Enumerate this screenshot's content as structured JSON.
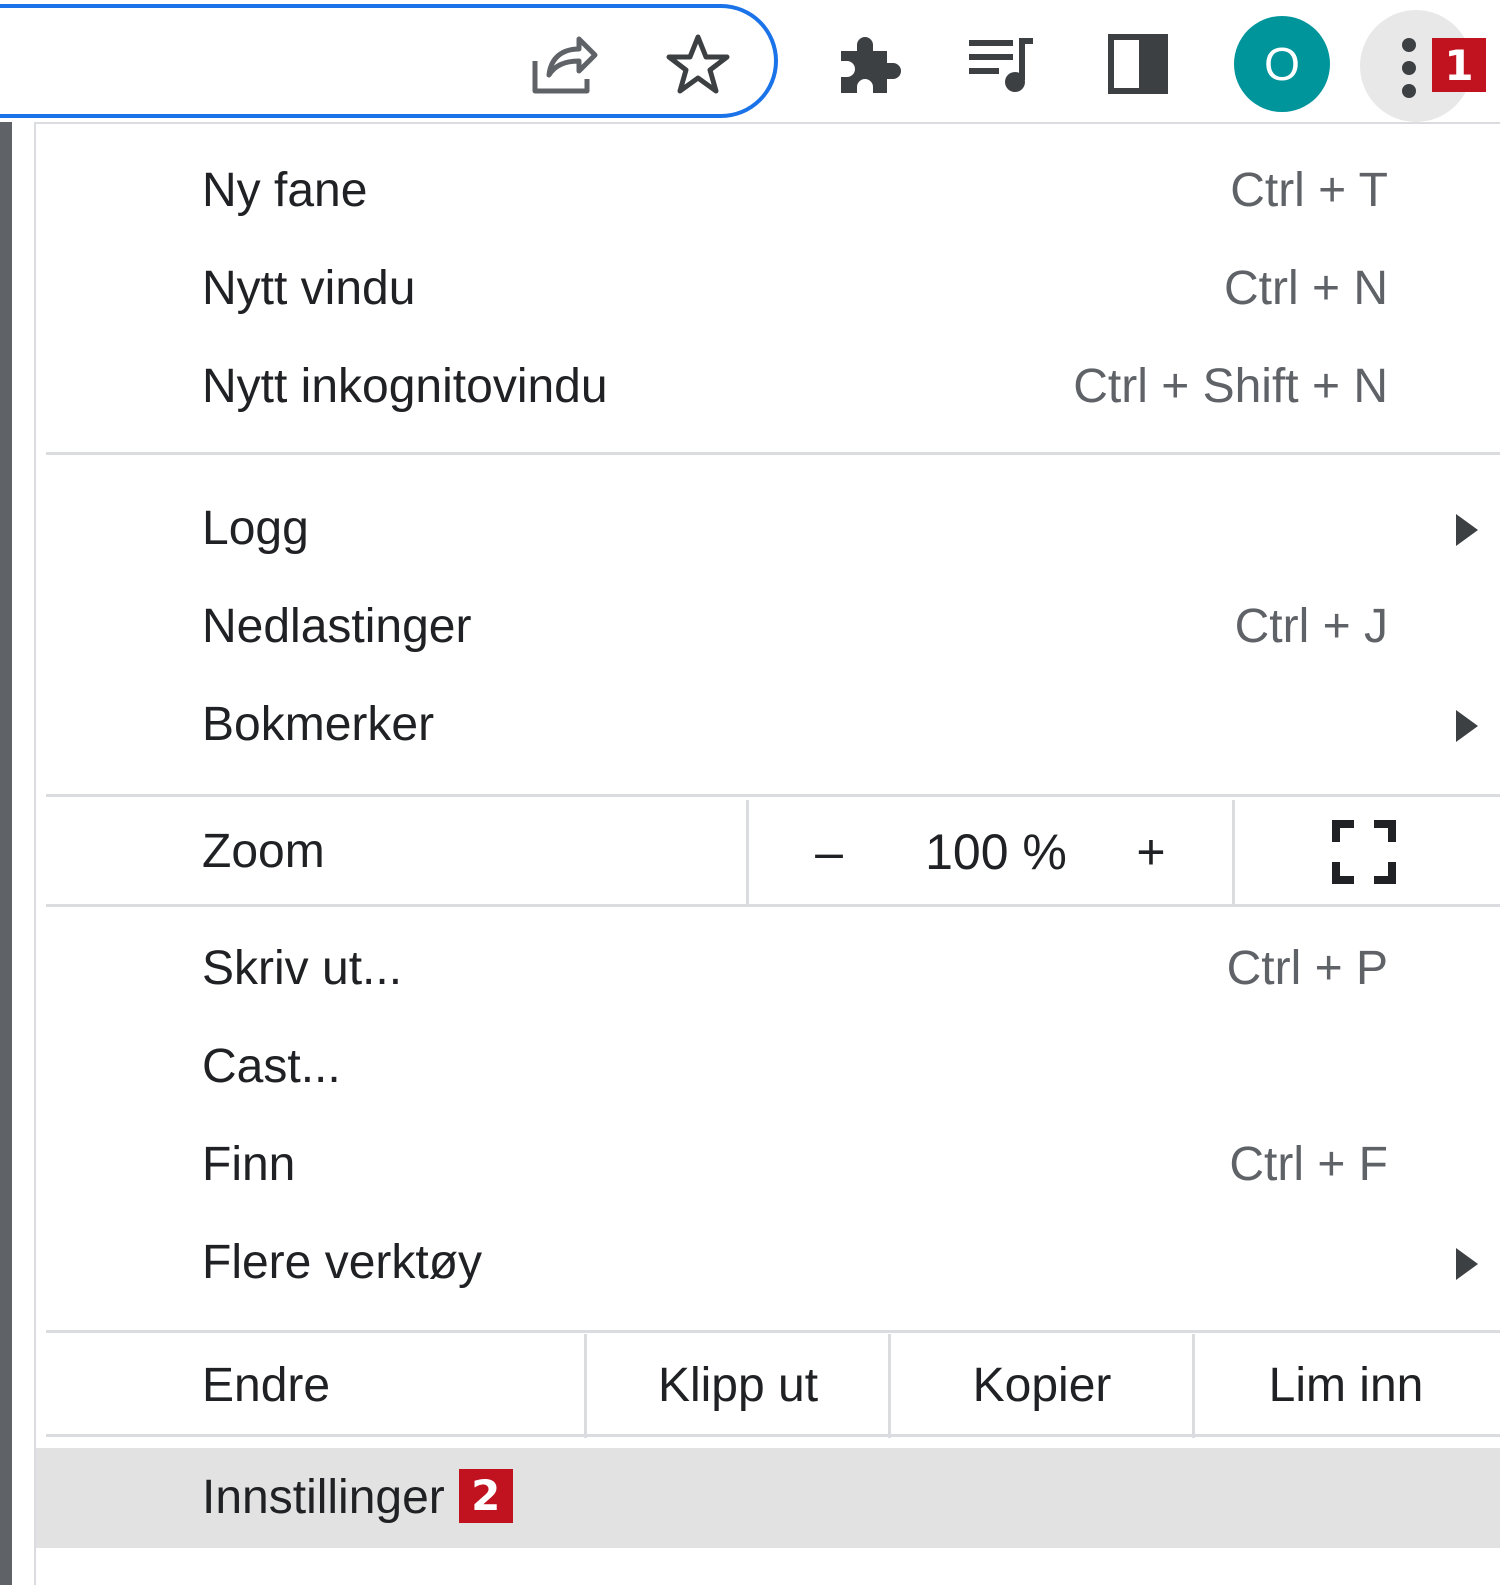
{
  "toolbar": {
    "icons": [
      "share-icon",
      "star-icon",
      "extensions-icon",
      "media-control-icon",
      "side-panel-icon",
      "more-vert-icon"
    ],
    "avatar_initial": "O",
    "step_badge_1": "1"
  },
  "colors": {
    "avatar_bg": "#00959b",
    "badge_bg": "#c1121f",
    "focus_ring": "#1a73e8",
    "hover_bg": "#e2e2e2"
  },
  "menu": {
    "items": [
      {
        "label": "Ny fane",
        "shortcut": "Ctrl + T"
      },
      {
        "label": "Nytt vindu",
        "shortcut": "Ctrl + N"
      },
      {
        "label": "Nytt inkognitovindu",
        "shortcut": "Ctrl + Shift + N"
      },
      {
        "label": "Logg",
        "shortcut": ""
      },
      {
        "label": "Nedlastinger",
        "shortcut": "Ctrl + J"
      },
      {
        "label": "Bokmerker",
        "shortcut": ""
      },
      {
        "label": "Skriv ut...",
        "shortcut": "Ctrl + P"
      },
      {
        "label": "Cast...",
        "shortcut": ""
      },
      {
        "label": "Finn",
        "shortcut": "Ctrl + F"
      },
      {
        "label": "Flere verktøy",
        "shortcut": ""
      },
      {
        "label": "Innstillinger",
        "shortcut": ""
      }
    ],
    "zoom": {
      "label": "Zoom",
      "minus": "–",
      "value": "100 %",
      "plus": "+"
    },
    "edit": {
      "label": "Endre",
      "cut": "Klipp ut",
      "copy": "Kopier",
      "paste": "Lim inn"
    },
    "step_badge_2": "2"
  }
}
